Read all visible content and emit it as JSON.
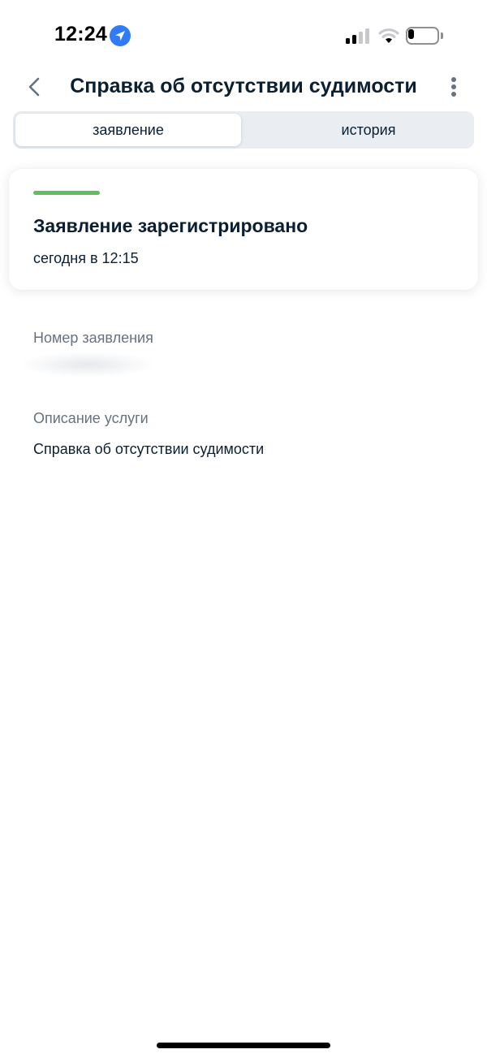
{
  "status_bar": {
    "time": "12:24",
    "location_icon": "location-arrow-icon",
    "signal_icon": "cellular-signal-icon",
    "wifi_icon": "wifi-icon",
    "battery_icon": "battery-icon",
    "battery_level": 0.2
  },
  "header": {
    "back_icon": "chevron-left-icon",
    "title": "Справка об отсутствии судимости",
    "more_icon": "more-vertical-icon"
  },
  "tabs": [
    {
      "label": "заявление",
      "active": true
    },
    {
      "label": "история",
      "active": false
    }
  ],
  "status_card": {
    "accent_color": "#5dc05a",
    "title": "Заявление зарегистрировано",
    "time": "сегодня в 12:15"
  },
  "fields": {
    "number_label": "Номер заявления",
    "description_label": "Описание услуги",
    "description_value": "Справка об отсутствии судимости"
  },
  "colors": {
    "text_primary": "#0b1f33",
    "text_secondary": "#66727f",
    "tabs_background": "#eaeef3",
    "location_badge": "#2f7cf6"
  }
}
